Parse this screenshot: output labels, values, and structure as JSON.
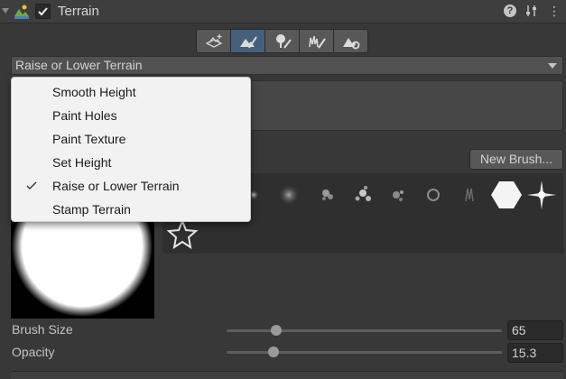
{
  "header": {
    "title": "Terrain",
    "enabled": true,
    "icons": [
      "terrain-icon",
      "help-icon",
      "presets-icon",
      "more-icon"
    ],
    "help_glyph": "?",
    "more_glyph": "⋮"
  },
  "toolbar": {
    "tools": [
      {
        "name": "create-neighbor-terrains",
        "active": false
      },
      {
        "name": "paint-terrain",
        "active": true
      },
      {
        "name": "paint-trees",
        "active": false
      },
      {
        "name": "paint-details",
        "active": false
      },
      {
        "name": "terrain-settings",
        "active": false
      }
    ]
  },
  "tool_dropdown": {
    "selected": "Raise or Lower Terrain"
  },
  "menu": {
    "items": [
      {
        "label": "Smooth Height",
        "checked": false
      },
      {
        "label": "Paint Holes",
        "checked": false
      },
      {
        "label": "Paint Texture",
        "checked": false
      },
      {
        "label": "Set Height",
        "checked": false
      },
      {
        "label": "Raise or Lower Terrain",
        "checked": true
      },
      {
        "label": "Stamp Terrain",
        "checked": false
      }
    ]
  },
  "brushes": {
    "new_brush_label": "New Brush...",
    "selected_index": 0
  },
  "properties": {
    "brush_size": {
      "label": "Brush Size",
      "value": "65",
      "slider_fraction": 0.18
    },
    "opacity": {
      "label": "Opacity",
      "value": "15.3",
      "slider_fraction": 0.17
    }
  },
  "colors": {
    "background": "#383838",
    "active_tool": "#46607c",
    "menu_background": "#f2f2f2",
    "enable_check": "#f0f0f0"
  }
}
